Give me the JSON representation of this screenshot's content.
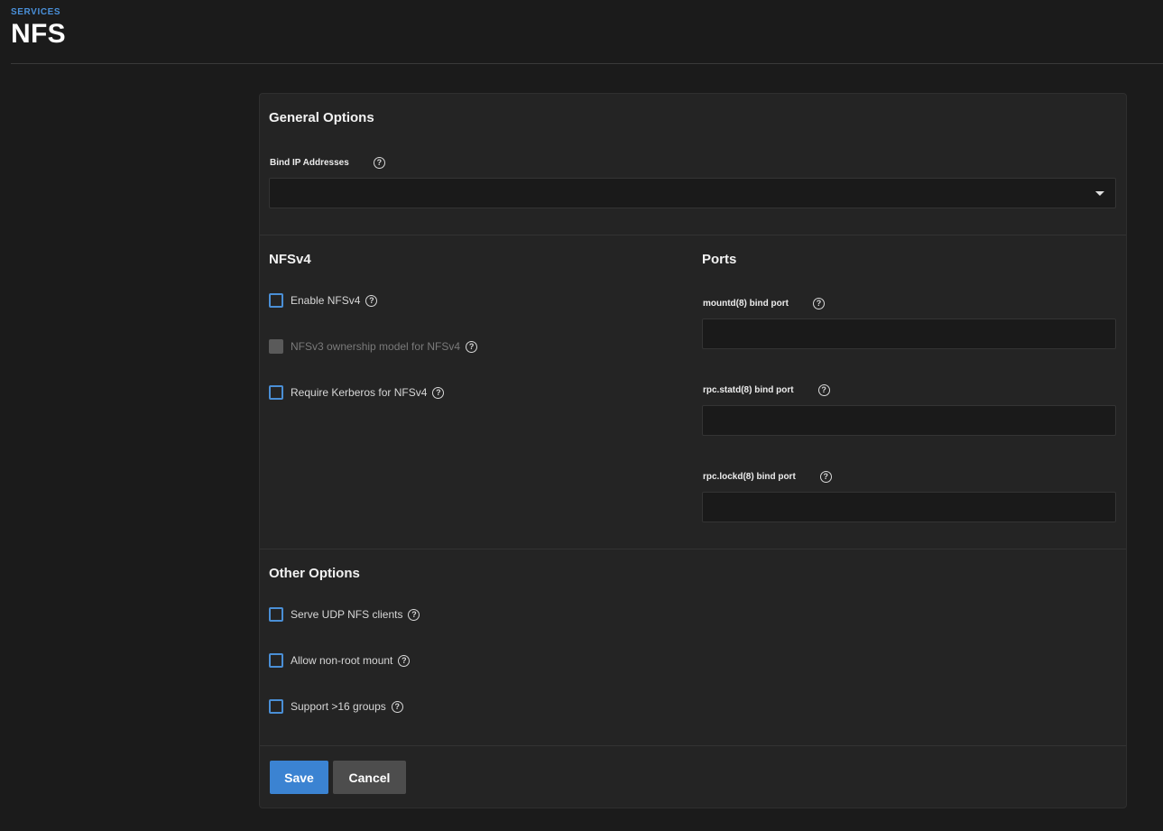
{
  "header": {
    "breadcrumb": "SERVICES",
    "title": "NFS"
  },
  "general_options": {
    "title": "General Options",
    "bind_ip_label": "Bind IP Addresses",
    "bind_ip_value": ""
  },
  "nfsv4": {
    "title": "NFSv4",
    "checkboxes": [
      {
        "label": "Enable NFSv4",
        "checked": false,
        "disabled": false
      },
      {
        "label": "NFSv3 ownership model for NFSv4",
        "checked": false,
        "disabled": true
      },
      {
        "label": "Require Kerberos for NFSv4",
        "checked": false,
        "disabled": false
      }
    ]
  },
  "ports": {
    "title": "Ports",
    "fields": [
      {
        "label": "mountd(8) bind port",
        "value": ""
      },
      {
        "label": "rpc.statd(8) bind port",
        "value": ""
      },
      {
        "label": "rpc.lockd(8) bind port",
        "value": ""
      }
    ]
  },
  "other_options": {
    "title": "Other Options",
    "checkboxes": [
      {
        "label": "Serve UDP NFS clients",
        "checked": false
      },
      {
        "label": "Allow non-root mount",
        "checked": false
      },
      {
        "label": "Support >16 groups",
        "checked": false
      }
    ]
  },
  "actions": {
    "save_label": "Save",
    "cancel_label": "Cancel"
  },
  "colors": {
    "accent": "#3b83d2",
    "background": "#1b1b1b",
    "card": "#242424"
  }
}
